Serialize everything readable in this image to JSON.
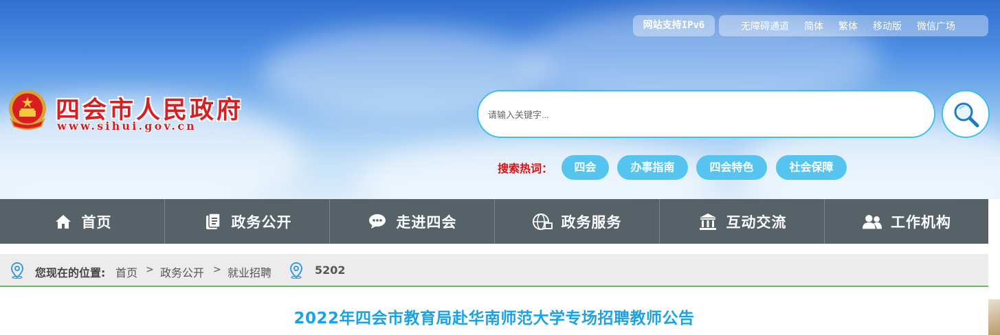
{
  "header": {
    "ipv6_label": "网站支持IPv6",
    "top_links": [
      "无障碍通道",
      "简体",
      "繁体",
      "移动版",
      "微信广场"
    ],
    "site_name": "四会市人民政府",
    "site_url": "www.sihui.gov.cn"
  },
  "search": {
    "placeholder": "请输入关键字...",
    "hot_label": "搜索热词：",
    "hot_words": [
      "四会",
      "办事指南",
      "四会特色",
      "社会保障"
    ]
  },
  "nav": {
    "items": [
      {
        "label": "首页",
        "icon": "home-icon"
      },
      {
        "label": "政务公开",
        "icon": "document-icon"
      },
      {
        "label": "走进四会",
        "icon": "chat-icon"
      },
      {
        "label": "政务服务",
        "icon": "globe-icon"
      },
      {
        "label": "互动交流",
        "icon": "building-icon"
      },
      {
        "label": "工作机构",
        "icon": "people-icon"
      }
    ]
  },
  "breadcrumb": {
    "title": "您现在的位置:",
    "items": [
      "首页",
      "政务公开",
      "就业招聘"
    ],
    "separator": ">",
    "views": "5202"
  },
  "article": {
    "title": "2022年四会市教育局赴华南师范大学专场招聘教师公告"
  },
  "colors": {
    "accent": "#1ba2e6",
    "brand_red": "#d81e20",
    "nav_bg": "#566168",
    "hot_tag": "#55c5f0",
    "search_border": "#3cc0ea"
  }
}
